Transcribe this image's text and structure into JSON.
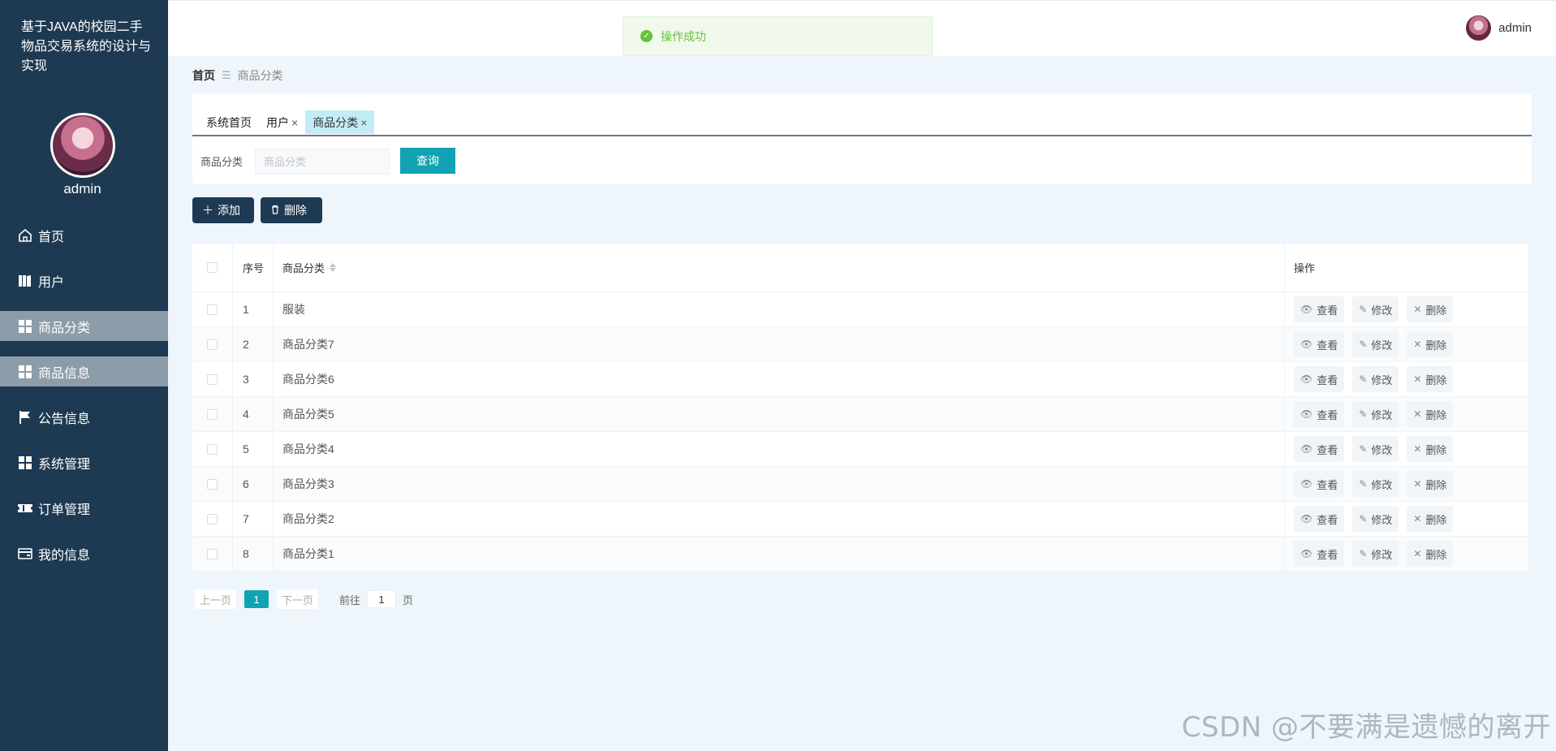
{
  "app": {
    "title": "基于JAVA的校园二手物品交易系统的设计与实现"
  },
  "sidebar": {
    "username": "admin",
    "items": [
      {
        "label": "首页",
        "icon": "home-icon",
        "active": false
      },
      {
        "label": "用户",
        "icon": "users-icon",
        "active": false
      },
      {
        "label": "商品分类",
        "icon": "grid-icon",
        "active": true
      },
      {
        "label": "商品信息",
        "icon": "grid-icon",
        "active": true
      },
      {
        "label": "公告信息",
        "icon": "flag-icon",
        "active": false
      },
      {
        "label": "系统管理",
        "icon": "grid-icon",
        "active": false
      },
      {
        "label": "订单管理",
        "icon": "ticket-icon",
        "active": false
      },
      {
        "label": "我的信息",
        "icon": "card-icon",
        "active": false
      }
    ]
  },
  "header": {
    "username": "admin"
  },
  "toast": {
    "message": "操作成功",
    "color": "#67c23a"
  },
  "breadcrumb": {
    "home": "首页",
    "current": "商品分类"
  },
  "tabs": [
    {
      "label": "系统首页",
      "closable": false,
      "active": false
    },
    {
      "label": "用户",
      "closable": true,
      "active": false
    },
    {
      "label": "商品分类",
      "closable": true,
      "active": true
    }
  ],
  "search": {
    "label": "商品分类",
    "placeholder": "商品分类",
    "button": "查询"
  },
  "actions": {
    "add": "添加",
    "delete": "删除"
  },
  "table": {
    "columns": {
      "index": "序号",
      "name": "商品分类",
      "ops": "操作"
    },
    "op_labels": {
      "view": "查看",
      "edit": "修改",
      "delete": "删除"
    },
    "rows": [
      {
        "index": "1",
        "name": "服装"
      },
      {
        "index": "2",
        "name": "商品分类7"
      },
      {
        "index": "3",
        "name": "商品分类6"
      },
      {
        "index": "4",
        "name": "商品分类5"
      },
      {
        "index": "5",
        "name": "商品分类4"
      },
      {
        "index": "6",
        "name": "商品分类3"
      },
      {
        "index": "7",
        "name": "商品分类2"
      },
      {
        "index": "8",
        "name": "商品分类1"
      }
    ]
  },
  "pagination": {
    "prev": "上一页",
    "current": "1",
    "next": "下一页",
    "goto": "前往",
    "goto_value": "1",
    "unit": "页"
  },
  "watermark": "CSDN @不要满是遗憾的离开",
  "colors": {
    "sidebar": "#1e3a52",
    "accent": "#11a3b3",
    "tab_active": "#c4ecf7"
  }
}
